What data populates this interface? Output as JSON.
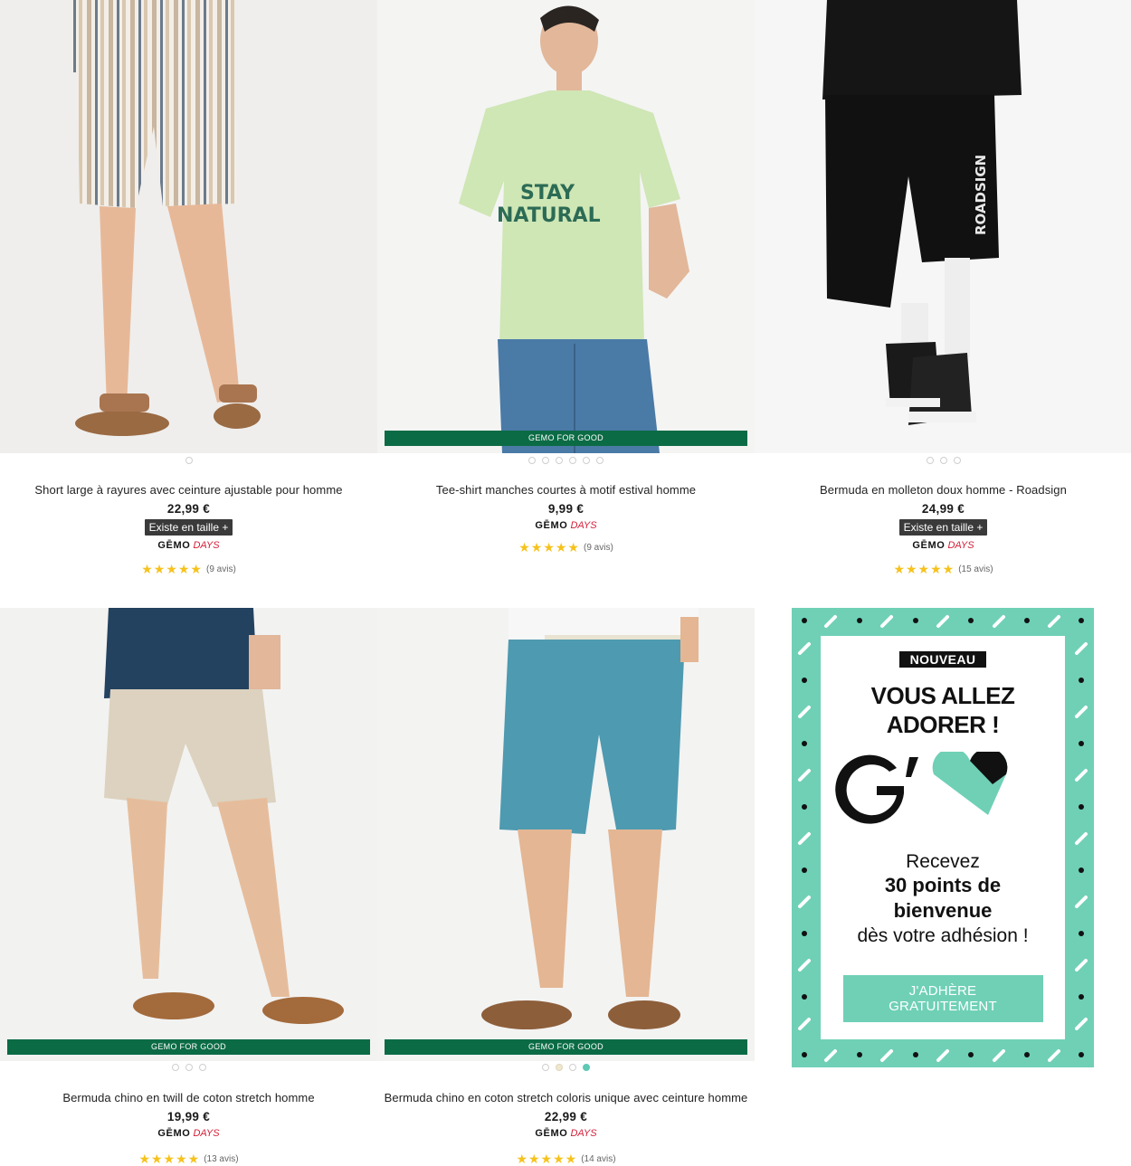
{
  "products": [
    {
      "title": "Short large à rayures avec ceinture ajustable pour homme",
      "price": "22,99 €",
      "size_tag": "Existe en taille +",
      "brand_gemo": "GĒMO",
      "brand_days": "DAYS",
      "stars": "★★★★★",
      "reviews": "(9 avis)",
      "badge": ""
    },
    {
      "title": "Tee-shirt manches courtes à motif estival homme",
      "price": "9,99 €",
      "size_tag": "",
      "brand_gemo": "GĒMO",
      "brand_days": "DAYS",
      "stars": "★★★★★",
      "reviews": "(9 avis)",
      "badge": "GEMO FOR GOOD"
    },
    {
      "title": "Bermuda en molleton doux homme - Roadsign",
      "price": "24,99 €",
      "size_tag": "Existe en taille +",
      "brand_gemo": "GĒMO",
      "brand_days": "DAYS",
      "stars": "★★★★★",
      "reviews": "(15 avis)",
      "badge": ""
    },
    {
      "title": "Bermuda chino en twill de coton stretch homme",
      "price": "19,99 €",
      "size_tag": "",
      "brand_gemo": "GĒMO",
      "brand_days": "DAYS",
      "stars": "★★★★★",
      "reviews": "(13 avis)",
      "badge": "GEMO FOR GOOD"
    },
    {
      "title": "Bermuda chino en coton stretch coloris unique avec ceinture homme",
      "price": "22,99 €",
      "size_tag": "",
      "brand_gemo": "GĒMO",
      "brand_days": "DAYS",
      "stars": "★★★★★",
      "reviews": "(14 avis)",
      "badge": "GEMO FOR GOOD"
    }
  ],
  "photo_texts": {
    "tshirt_print_line1": "STAY",
    "tshirt_print_line2": "NATURAL",
    "shorts_print": "ROADSIGN"
  },
  "promo": {
    "badge": "NOUVEAU",
    "headline_line1": "VOUS ALLEZ",
    "headline_line2": "ADORER !",
    "text_line1": "Recevez",
    "text_line2": "30 points de",
    "text_line3": "bienvenue",
    "text_line4": "dès votre adhésion !",
    "button": "J'ADHÈRE GRATUITEMENT"
  },
  "colors": {
    "eco_green": "#0b6b45",
    "promo_mint": "#6fd0b6",
    "star_yellow": "#f6c21c",
    "days_red": "#d3213a"
  }
}
